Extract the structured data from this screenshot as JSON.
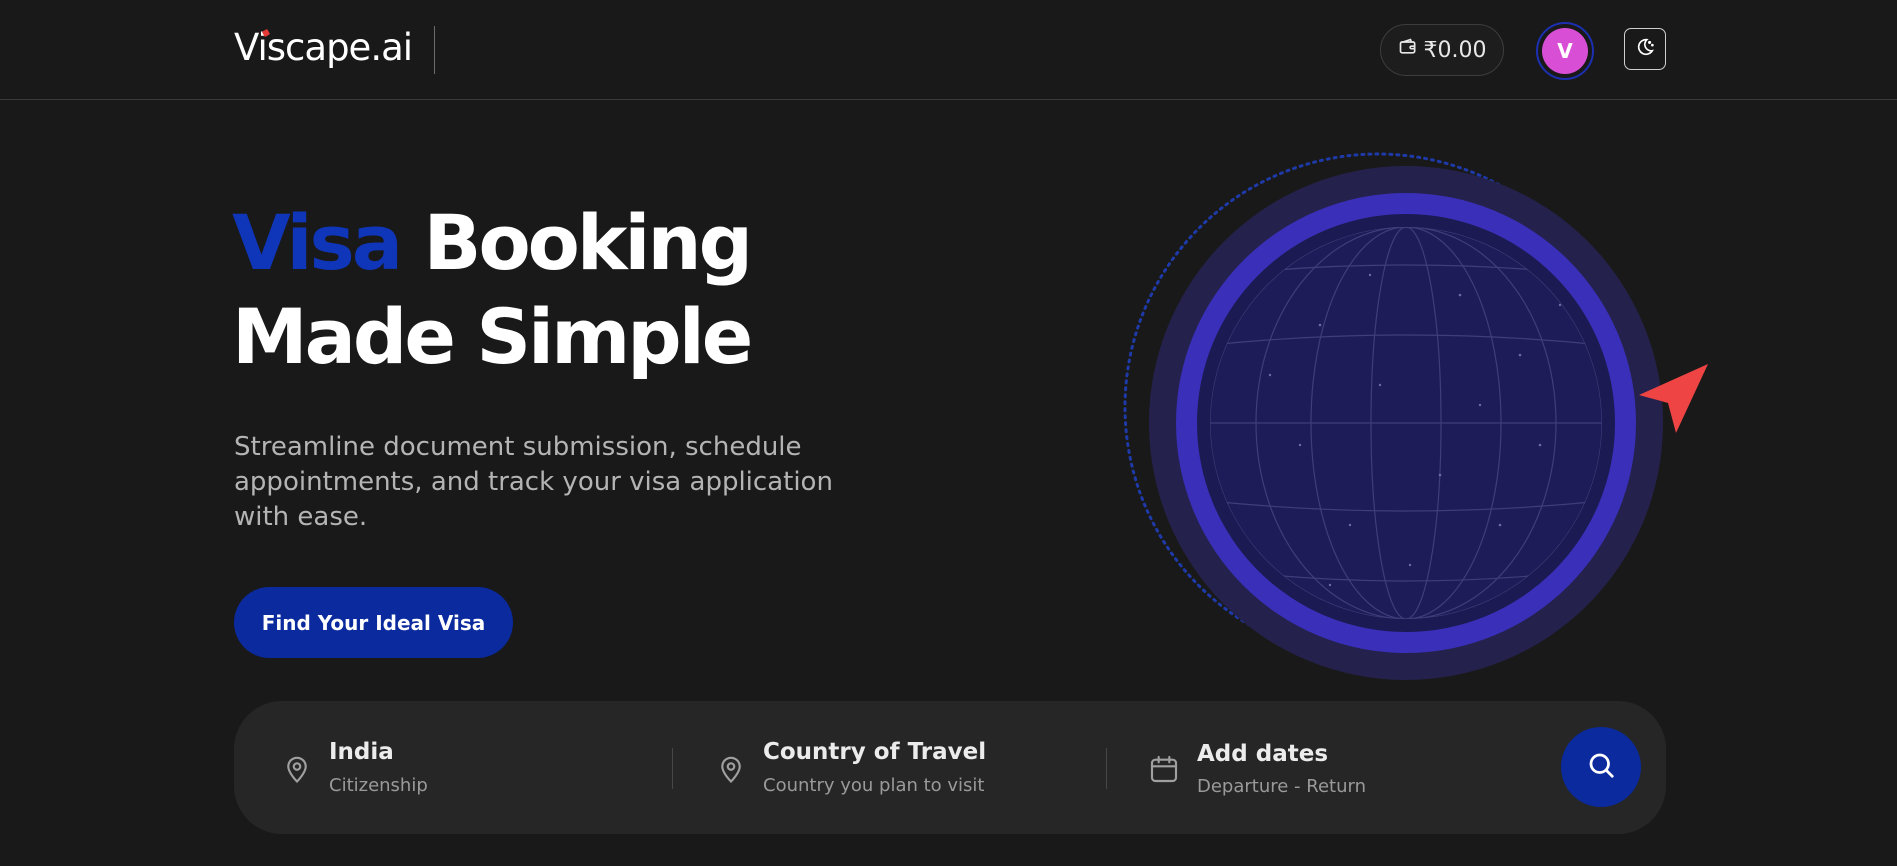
{
  "header": {
    "logo": "Viscape.ai",
    "wallet_balance": "₹0.00",
    "avatar_initial": "V",
    "icons": {
      "wallet": "wallet-icon",
      "theme": "moon-icon"
    }
  },
  "hero": {
    "title_accent": "Visa",
    "title_line1_rest": "Booking",
    "title_line2": "Made Simple",
    "subtitle": "Streamline document submission, schedule appointments, and track your visa application with ease.",
    "cta_label": "Find Your Ideal Visa"
  },
  "search": {
    "fields": [
      {
        "title": "India",
        "subtitle": "Citizenship",
        "icon": "location-pin-icon"
      },
      {
        "title": "Country of Travel",
        "subtitle": "Country you plan to visit",
        "icon": "location-pin-icon"
      },
      {
        "title": "Add dates",
        "subtitle": "Departure - Return",
        "icon": "calendar-icon"
      }
    ],
    "button_icon": "search-icon"
  },
  "colors": {
    "background": "#191919",
    "accent_blue": "#0a2a9e",
    "title_accent": "#0f35b8",
    "avatar": "#d84fd6",
    "plane": "#ef4444",
    "globe_ring": "#3a2fb8"
  }
}
